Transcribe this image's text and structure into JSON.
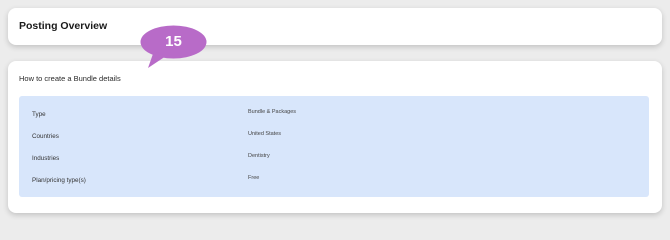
{
  "header": {
    "title": "Posting Overview"
  },
  "callout": {
    "number": "15",
    "color": "#b86bc8"
  },
  "section": {
    "title": "How to create a Bundle details",
    "rows": [
      {
        "label": "Type",
        "value": "Bundle & Packages"
      },
      {
        "label": "Countries",
        "value": "United States"
      },
      {
        "label": "Industries",
        "value": "Dentistry"
      },
      {
        "label": "Plan/pricing type(s)",
        "value": "Free"
      }
    ]
  },
  "colors": {
    "background": "#ececec",
    "detail_panel": "#d8e6fb"
  }
}
